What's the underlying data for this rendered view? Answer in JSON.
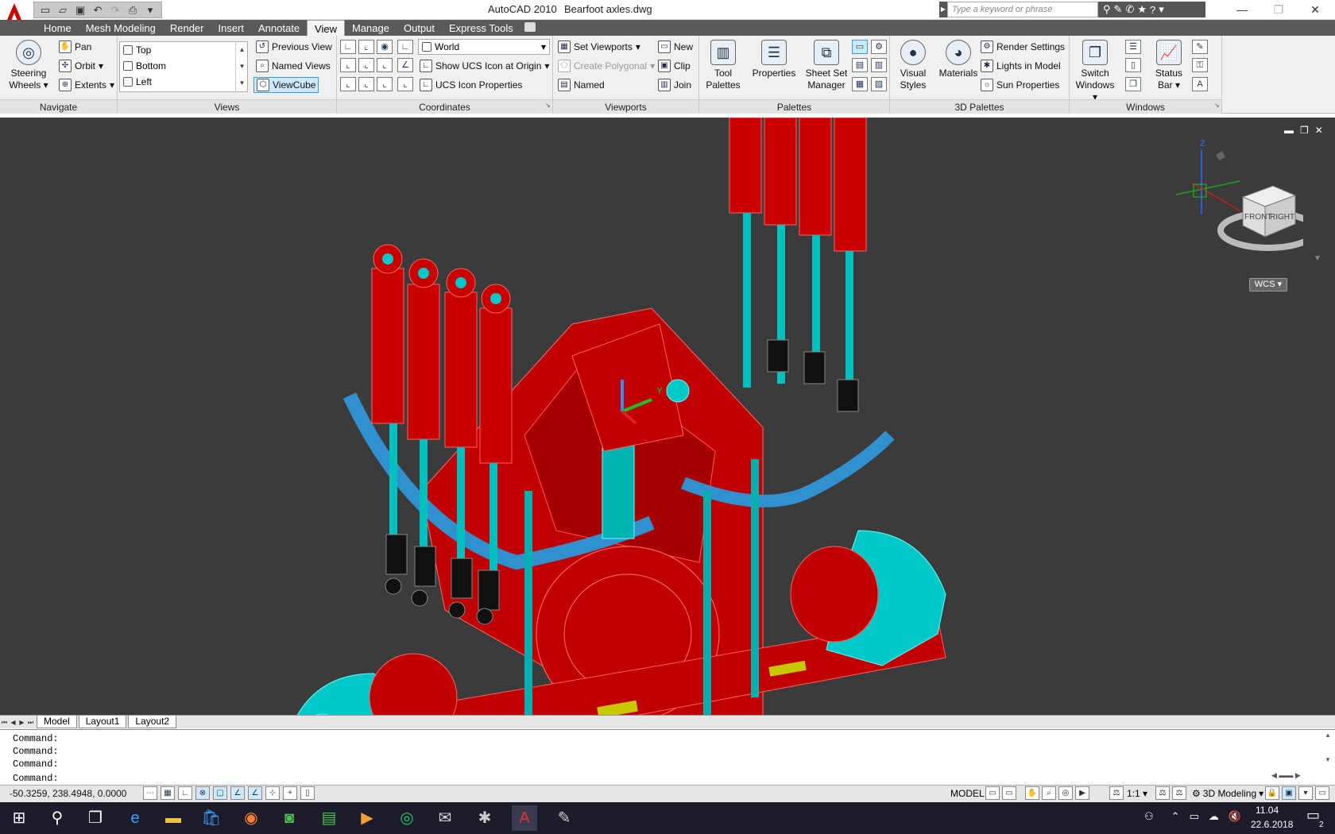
{
  "app": {
    "title": "AutoCAD 2010",
    "file": "Bearfoot axles.dwg",
    "search_placeholder": "Type a keyword or phrase"
  },
  "tabs": [
    "Home",
    "Mesh Modeling",
    "Render",
    "Insert",
    "Annotate",
    "View",
    "Manage",
    "Output",
    "Express Tools"
  ],
  "active_tab": "View",
  "ribbon": {
    "navigate": {
      "title": "Navigate",
      "steering_label": "Steering",
      "steering_label2": "Wheels",
      "pan": "Pan",
      "orbit": "Orbit",
      "extents": "Extents"
    },
    "views": {
      "title": "Views",
      "list": [
        "Top",
        "Bottom",
        "Left"
      ],
      "previous_view": "Previous View",
      "named_views": "Named Views",
      "viewcube": "ViewCube"
    },
    "coordinates": {
      "title": "Coordinates",
      "world": "World",
      "show_ucs_icon": "Show UCS Icon at Origin",
      "ucs_icon_properties": "UCS Icon Properties"
    },
    "viewports": {
      "title": "Viewports",
      "set_viewports": "Set Viewports",
      "create_polygonal": "Create Polygonal",
      "named": "Named",
      "new": "New",
      "clip": "Clip",
      "join": "Join"
    },
    "palettes": {
      "title": "Palettes",
      "tool_palettes": "Tool",
      "tool_palettes2": "Palettes",
      "properties": "Properties",
      "sheet_set": "Sheet Set",
      "sheet_set2": "Manager"
    },
    "palettes3d": {
      "title": "3D Palettes",
      "visual_styles": "Visual",
      "visual_styles2": "Styles",
      "materials": "Materials",
      "render_settings": "Render Settings",
      "lights_in_model": "Lights in Model",
      "sun_properties": "Sun Properties"
    },
    "windows": {
      "title": "Windows",
      "switch_windows": "Switch",
      "switch_windows2": "Windows",
      "status_bar": "Status",
      "status_bar2": "Bar"
    }
  },
  "viewcube": {
    "front": "FRONT",
    "right": "RIGHT",
    "wcs": "WCS",
    "z": "Z",
    "y": "Y"
  },
  "layout_tabs": [
    "Model",
    "Layout1",
    "Layout2"
  ],
  "command_lines": [
    "Command:",
    "Command:",
    "Command:",
    "Command:"
  ],
  "status": {
    "coords": "-50.3259, 238.4948, 0.0000",
    "model": "MODEL",
    "scale": "1:1",
    "workspace": "3D Modeling"
  },
  "clock": {
    "time": "11.04",
    "date": "22.6.2018",
    "notifications": "2"
  },
  "colors": {
    "red": "#cc0000",
    "cyan": "#00c8c8",
    "viewport_bg": "#3b3b3b",
    "yellow": "#c8c800"
  }
}
